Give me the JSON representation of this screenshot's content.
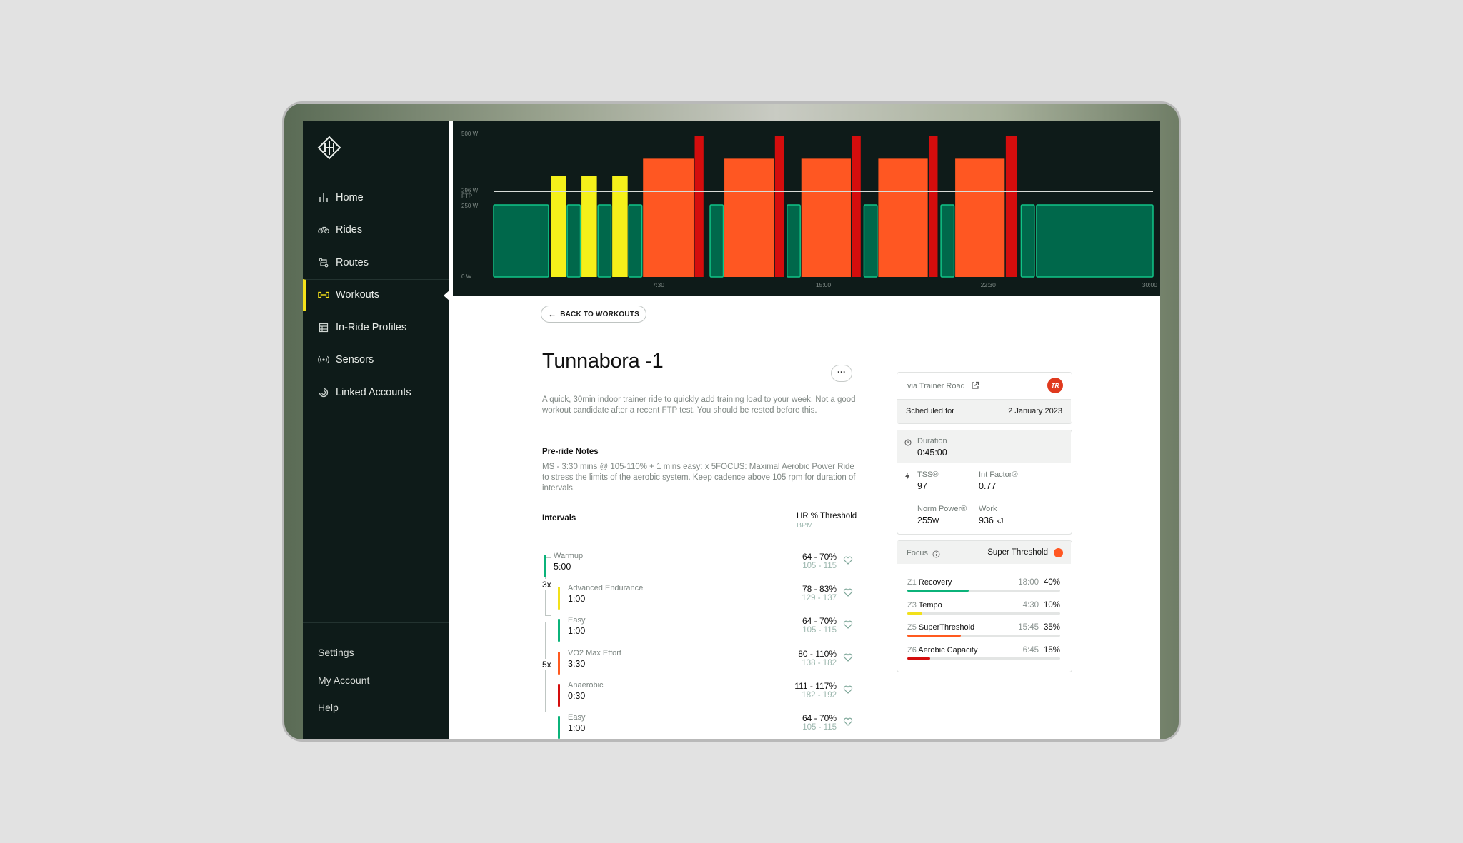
{
  "nav": {
    "items": [
      {
        "label": "Home",
        "icon": "bar-chart-icon"
      },
      {
        "label": "Rides",
        "icon": "bike-icon"
      },
      {
        "label": "Routes",
        "icon": "route-icon"
      },
      {
        "label": "Workouts",
        "icon": "dumbbell-icon",
        "active": true
      },
      {
        "label": "In-Ride Profiles",
        "icon": "profile-icon"
      },
      {
        "label": "Sensors",
        "icon": "sensor-icon"
      },
      {
        "label": "Linked Accounts",
        "icon": "link-icon"
      }
    ],
    "footer": [
      "Settings",
      "My Account",
      "Help"
    ]
  },
  "chart_data": {
    "type": "bar",
    "y_ticks": [
      "500 W",
      "296 W",
      "FTP",
      "250 W",
      "0 W"
    ],
    "x_ticks": [
      "7:30",
      "15:00",
      "22:30",
      "30:00"
    ],
    "ftp_watts": 296,
    "ylim": [
      0,
      500
    ],
    "xlim": [
      0,
      30
    ],
    "zone_colors": {
      "recovery": "#00684b",
      "tempo": "#f5f01a",
      "superthreshold": "#ff5722",
      "anaerobic": "#d40d0d"
    },
    "segments": [
      {
        "start": 0,
        "end": 2.5,
        "watts": 250,
        "zone": "recovery"
      },
      {
        "start": 2.6,
        "end": 3.3,
        "watts": 350,
        "zone": "tempo"
      },
      {
        "start": 3.35,
        "end": 3.95,
        "watts": 250,
        "zone": "recovery"
      },
      {
        "start": 4.0,
        "end": 4.7,
        "watts": 350,
        "zone": "tempo"
      },
      {
        "start": 4.75,
        "end": 5.35,
        "watts": 250,
        "zone": "recovery"
      },
      {
        "start": 5.4,
        "end": 6.1,
        "watts": 350,
        "zone": "tempo"
      },
      {
        "start": 6.15,
        "end": 6.75,
        "watts": 250,
        "zone": "recovery"
      },
      {
        "start": 6.8,
        "end": 9.1,
        "watts": 410,
        "zone": "superthreshold"
      },
      {
        "start": 9.15,
        "end": 9.55,
        "watts": 490,
        "zone": "anaerobic"
      },
      {
        "start": 9.85,
        "end": 10.45,
        "watts": 250,
        "zone": "recovery"
      },
      {
        "start": 10.5,
        "end": 12.75,
        "watts": 410,
        "zone": "superthreshold"
      },
      {
        "start": 12.8,
        "end": 13.2,
        "watts": 490,
        "zone": "anaerobic"
      },
      {
        "start": 13.35,
        "end": 13.95,
        "watts": 250,
        "zone": "recovery"
      },
      {
        "start": 14.0,
        "end": 16.25,
        "watts": 410,
        "zone": "superthreshold"
      },
      {
        "start": 16.3,
        "end": 16.7,
        "watts": 490,
        "zone": "anaerobic"
      },
      {
        "start": 16.85,
        "end": 17.45,
        "watts": 250,
        "zone": "recovery"
      },
      {
        "start": 17.5,
        "end": 19.75,
        "watts": 410,
        "zone": "superthreshold"
      },
      {
        "start": 19.8,
        "end": 20.2,
        "watts": 490,
        "zone": "anaerobic"
      },
      {
        "start": 20.35,
        "end": 20.95,
        "watts": 250,
        "zone": "recovery"
      },
      {
        "start": 21.0,
        "end": 23.25,
        "watts": 410,
        "zone": "superthreshold"
      },
      {
        "start": 23.3,
        "end": 23.8,
        "watts": 490,
        "zone": "anaerobic"
      },
      {
        "start": 24.0,
        "end": 24.6,
        "watts": 250,
        "zone": "recovery"
      },
      {
        "start": 24.7,
        "end": 30.0,
        "watts": 250,
        "zone": "recovery"
      }
    ]
  },
  "back_label": "BACK TO WORKOUTS",
  "workout": {
    "title": "Tunnabora -1",
    "more": "···",
    "description": "A quick, 30min indoor trainer ride to quickly add training load to your week. Not a good workout candidate after a recent FTP test. You should be rested before this.",
    "pre_ride_title": "Pre-ride Notes",
    "pre_ride_notes": "MS - 3:30 mins @ 105-110% + 1 mins easy: x 5FOCUS: Maximal Aerobic Power Ride to stress the limits of the aerobic system. Keep cadence above 105 rpm for duration of intervals."
  },
  "intervals": {
    "title": "Intervals",
    "hr_header": "HR % Threshold",
    "hr_sub": "BPM",
    "rows": [
      {
        "name": "Warmup",
        "time": "5:00",
        "pct": "64 - 70%",
        "bpm": "105 - 115",
        "color": "#0bb37a"
      },
      {
        "name": "Advanced Endurance",
        "time": "1:00",
        "pct": "78 - 83%",
        "bpm": "129 - 137",
        "color": "#f2e11a"
      },
      {
        "name": "Easy",
        "time": "1:00",
        "pct": "64 - 70%",
        "bpm": "105 - 115",
        "color": "#0bb37a"
      },
      {
        "name": "VO2 Max Effort",
        "time": "3:30",
        "pct": "80 - 110%",
        "bpm": "138 - 182",
        "color": "#ff5a1f"
      },
      {
        "name": "Anaerobic",
        "time": "0:30",
        "pct": "111 - 117%",
        "bpm": "182 - 192",
        "color": "#d40d0d"
      },
      {
        "name": "Easy",
        "time": "1:00",
        "pct": "64 - 70%",
        "bpm": "105 - 115",
        "color": "#0bb37a"
      }
    ],
    "rep1": "3x",
    "rep2": "5x"
  },
  "source": {
    "via": "via Trainer Road",
    "badge": "TR",
    "scheduled_label": "Scheduled for",
    "scheduled_value": "2 January 2023"
  },
  "stats": {
    "duration_label": "Duration",
    "duration_value": "0:45:00",
    "tss_label": "TSS®",
    "tss_value": "97",
    "if_label": "Int Factor®",
    "if_value": "0.77",
    "np_label": "Norm Power®",
    "np_value": "255",
    "np_unit": "W",
    "work_label": "Work",
    "work_value": "936",
    "work_unit": "kJ"
  },
  "focus": {
    "label": "Focus",
    "value": "Super Threshold",
    "color": "#ff5722",
    "zones": [
      {
        "code": "Z1",
        "name": "Recovery",
        "time": "18:00",
        "pct": "40%",
        "fraction": 0.4,
        "color": "#0bb37a"
      },
      {
        "code": "Z3",
        "name": "Tempo",
        "time": "4:30",
        "pct": "10%",
        "fraction": 0.1,
        "color": "#f2e11a"
      },
      {
        "code": "Z5",
        "name": "SuperThreshold",
        "time": "15:45",
        "pct": "35%",
        "fraction": 0.35,
        "color": "#ff5a1f"
      },
      {
        "code": "Z6",
        "name": "Aerobic Capacity",
        "time": "6:45",
        "pct": "15%",
        "fraction": 0.15,
        "color": "#d40d0d"
      }
    ]
  }
}
